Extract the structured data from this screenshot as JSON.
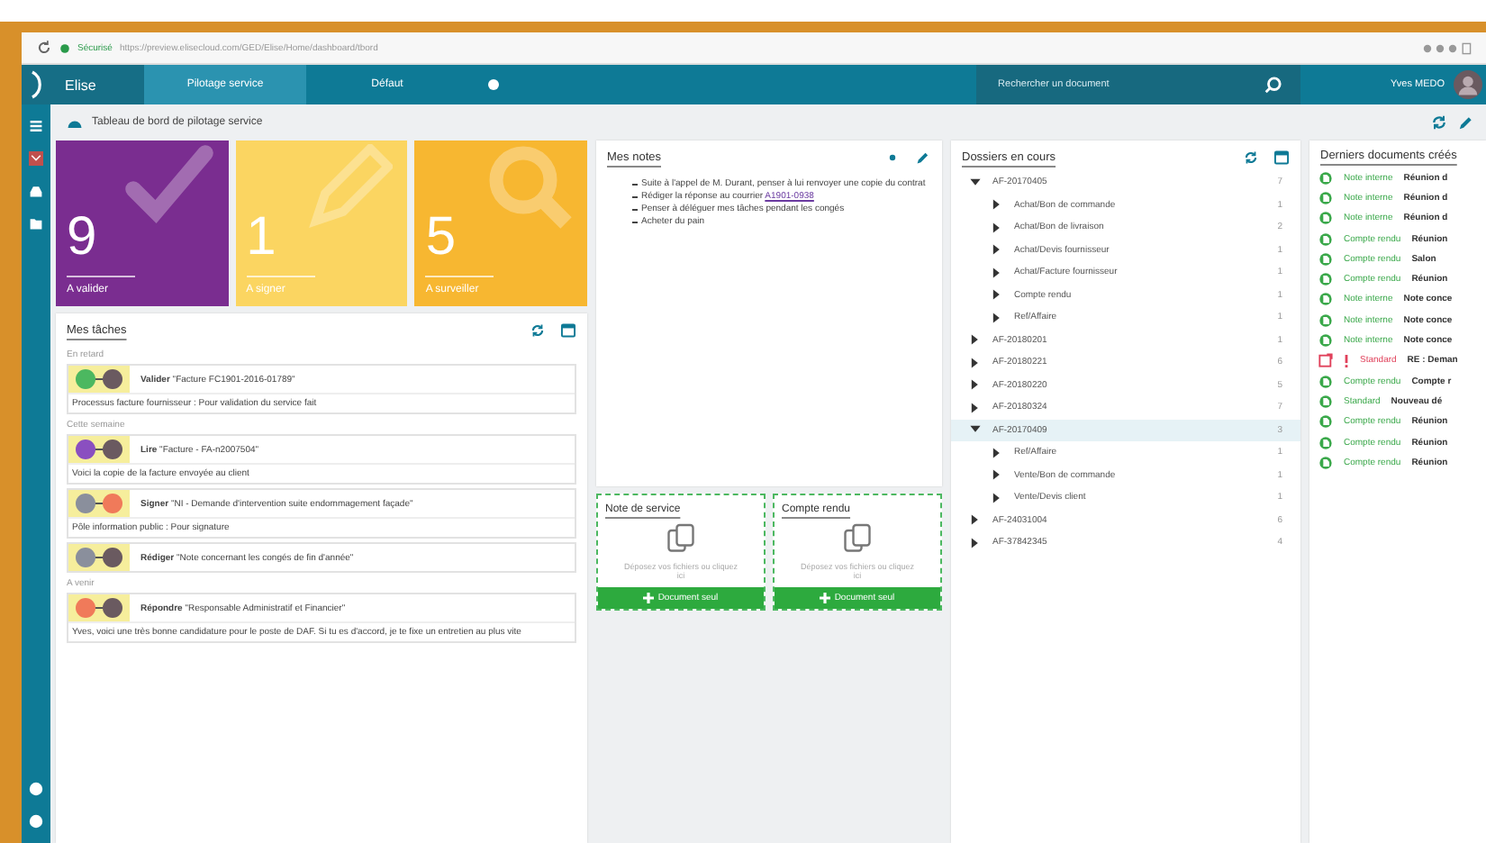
{
  "browser": {
    "secure_label": "Sécurisé",
    "url": "https://preview.elisecloud.com/GED/Elise/Home/dashboard/tbord"
  },
  "nav": {
    "app_name": "Elise",
    "tabs": [
      {
        "label": "Pilotage service",
        "selected": true
      },
      {
        "label": "Défaut",
        "selected": false
      }
    ],
    "search": {
      "placeholder": "Rechercher un document"
    },
    "user": "Yves MEDO"
  },
  "page_title": "Tableau de bord de pilotage service",
  "tiles": [
    {
      "count": "9",
      "label": "A valider",
      "kind": "validate"
    },
    {
      "count": "1",
      "label": "A signer",
      "kind": "sign"
    },
    {
      "count": "5",
      "label": "A surveiller",
      "kind": "watch"
    }
  ],
  "tasks_panel": {
    "title": "Mes tâches",
    "groups": [
      {
        "label": "En retard",
        "tasks": [
          {
            "avatars": [
              {
                "color": "#4cb860"
              },
              {
                "color": "#6a5a60"
              }
            ],
            "verb": "Valider",
            "subject": "\"Facture FC1901-2016-01789\"",
            "note": "Processus facture fournisseur : Pour validation du service fait",
            "highlighted": true
          }
        ]
      },
      {
        "label": "Cette semaine",
        "tasks": [
          {
            "avatars": [
              {
                "color": "#8a4fc0"
              },
              {
                "color": "#6a5a60"
              }
            ],
            "verb": "Lire",
            "subject": "\"Facture - FA-n2007504\"",
            "note": "Voici la copie de la facture envoyée au client",
            "highlighted": true
          },
          {
            "avatars": [
              {
                "color": "#8a8f9c"
              },
              {
                "color": "#f07a5a"
              }
            ],
            "verb": "Signer",
            "subject": "\"NI - Demande d'intervention suite endommagement façade\"",
            "note": "Pôle information public : Pour signature",
            "highlighted": true
          },
          {
            "avatars": [
              {
                "color": "#8a8f9c"
              },
              {
                "color": "#6a5a60"
              }
            ],
            "verb": "Rédiger",
            "subject": "\"Note concernant les congés de fin d'année\"",
            "highlighted": true
          }
        ]
      },
      {
        "label": "A venir",
        "tasks": [
          {
            "avatars": [
              {
                "color": "#f07a5a"
              },
              {
                "color": "#6a5a60"
              }
            ],
            "verb": "Répondre",
            "subject": "\"Responsable Administratif et Financier\"",
            "note": "Yves, voici une très bonne candidature pour le poste de DAF. Si tu es d'accord, je te fixe un entretien au plus vite",
            "highlighted": true
          }
        ]
      }
    ]
  },
  "notes_panel": {
    "title": "Mes notes",
    "items": [
      {
        "text": "Suite à l'appel de M. Durant, penser à lui renvoyer une copie du contrat"
      },
      {
        "text": "Rédiger la réponse au courrier",
        "link": "A1901-0938"
      },
      {
        "text": "Penser à déléguer mes tâches pendant les congés"
      },
      {
        "text": "Acheter du pain"
      }
    ]
  },
  "drop_zones": [
    {
      "title": "Note de service",
      "hint": "Déposez vos fichiers ou cliquez ici",
      "button": "Document seul"
    },
    {
      "title": "Compte rendu",
      "hint": "Déposez vos fichiers ou cliquez ici",
      "button": "Document seul"
    }
  ],
  "folders_panel": {
    "title": "Dossiers en cours",
    "tree": [
      {
        "label": "AF-20170405",
        "count": "7",
        "expanded": true,
        "selected": false,
        "children": [
          {
            "label": "Achat/Bon de commande",
            "count": "1",
            "expanded": false,
            "selected": false
          },
          {
            "label": "Achat/Bon de livraison",
            "count": "2",
            "expanded": false,
            "selected": false
          },
          {
            "label": "Achat/Devis fournisseur",
            "count": "1",
            "expanded": false,
            "selected": false
          },
          {
            "label": "Achat/Facture fournisseur",
            "count": "1",
            "expanded": false,
            "selected": false
          },
          {
            "label": "Compte rendu",
            "count": "1",
            "expanded": false,
            "selected": false
          },
          {
            "label": "Ref/Affaire",
            "count": "1",
            "expanded": false,
            "selected": false
          }
        ]
      },
      {
        "label": "AF-20180201",
        "count": "1",
        "expanded": false,
        "selected": false
      },
      {
        "label": "AF-20180221",
        "count": "6",
        "expanded": false,
        "selected": false
      },
      {
        "label": "AF-20180220",
        "count": "5",
        "expanded": false,
        "selected": false
      },
      {
        "label": "AF-20180324",
        "count": "7",
        "expanded": false,
        "selected": false
      },
      {
        "label": "AF-20170409",
        "count": "3",
        "expanded": true,
        "selected": true,
        "children": [
          {
            "label": "Ref/Affaire",
            "count": "1",
            "expanded": false,
            "selected": false
          },
          {
            "label": "Vente/Bon de commande",
            "count": "1",
            "expanded": false,
            "selected": false
          },
          {
            "label": "Vente/Devis client",
            "count": "1",
            "expanded": false,
            "selected": false
          }
        ]
      },
      {
        "label": "AF-24031004",
        "count": "6",
        "expanded": false,
        "selected": false
      },
      {
        "label": "AF-37842345",
        "count": "4",
        "expanded": false,
        "selected": false
      }
    ]
  },
  "documents_panel": {
    "title": "Derniers documents créés",
    "rows": [
      {
        "type": "Note interne",
        "title": "Réunion d",
        "urgent": false
      },
      {
        "type": "Note interne",
        "title": "Réunion d",
        "urgent": false
      },
      {
        "type": "Note interne",
        "title": "Réunion d",
        "urgent": false
      },
      {
        "type": "Compte rendu",
        "title": "Réunion",
        "urgent": false
      },
      {
        "type": "Compte rendu",
        "title": "Salon",
        "urgent": false
      },
      {
        "type": "Compte rendu",
        "title": "Réunion",
        "urgent": false
      },
      {
        "type": "Note interne",
        "title": "Note conce",
        "urgent": false
      },
      {
        "type": "Note interne",
        "title": "Note conce",
        "urgent": false
      },
      {
        "type": "Note interne",
        "title": "Note conce",
        "urgent": false
      },
      {
        "type": "Standard",
        "title": "RE : Deman",
        "urgent": true
      },
      {
        "type": "Compte rendu",
        "title": "Compte r",
        "urgent": false
      },
      {
        "type": "Standard",
        "title": "Nouveau dé",
        "urgent": false
      },
      {
        "type": "Compte rendu",
        "title": "Réunion",
        "urgent": false
      },
      {
        "type": "Compte rendu",
        "title": "Réunion",
        "urgent": false
      },
      {
        "type": "Compte rendu",
        "title": "Réunion",
        "urgent": false
      }
    ]
  }
}
